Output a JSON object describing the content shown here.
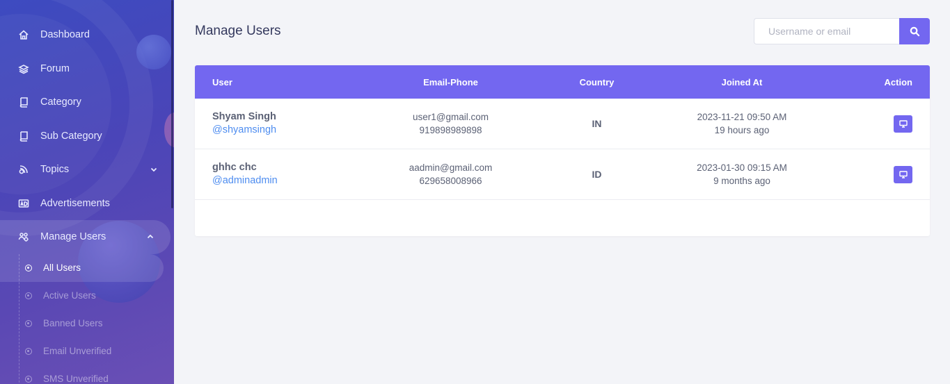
{
  "sidebar": {
    "items": [
      {
        "label": "Dashboard",
        "icon": "home-icon"
      },
      {
        "label": "Forum",
        "icon": "layers-icon"
      },
      {
        "label": "Category",
        "icon": "book-icon"
      },
      {
        "label": "Sub Category",
        "icon": "book-icon"
      },
      {
        "label": "Topics",
        "icon": "topics-icon"
      },
      {
        "label": "Advertisements",
        "icon": "ad-icon"
      },
      {
        "label": "Manage Users",
        "icon": "users-cog-icon"
      }
    ],
    "submenu": [
      {
        "label": "All Users"
      },
      {
        "label": "Active Users"
      },
      {
        "label": "Banned Users"
      },
      {
        "label": "Email Unverified"
      },
      {
        "label": "SMS Unverified"
      }
    ]
  },
  "header": {
    "title": "Manage Users",
    "search_placeholder": "Username or email"
  },
  "table": {
    "columns": [
      "User",
      "Email-Phone",
      "Country",
      "Joined At",
      "Action"
    ],
    "rows": [
      {
        "name": "Shyam Singh",
        "handle": "@shyamsingh",
        "email": "user1@gmail.com",
        "phone": "919898989898",
        "country": "IN",
        "joined": "2023-11-21 09:50 AM",
        "joined_rel": "19 hours ago"
      },
      {
        "name": "ghhc chc",
        "handle": "@adminadmin",
        "email": "aadmin@gmail.com",
        "phone": "629658008966",
        "country": "ID",
        "joined": "2023-01-30 09:15 AM",
        "joined_rel": "9 months ago"
      }
    ]
  },
  "colors": {
    "accent": "#7367f0",
    "link": "#4e8df0",
    "sidebar": "#4a45b8"
  }
}
